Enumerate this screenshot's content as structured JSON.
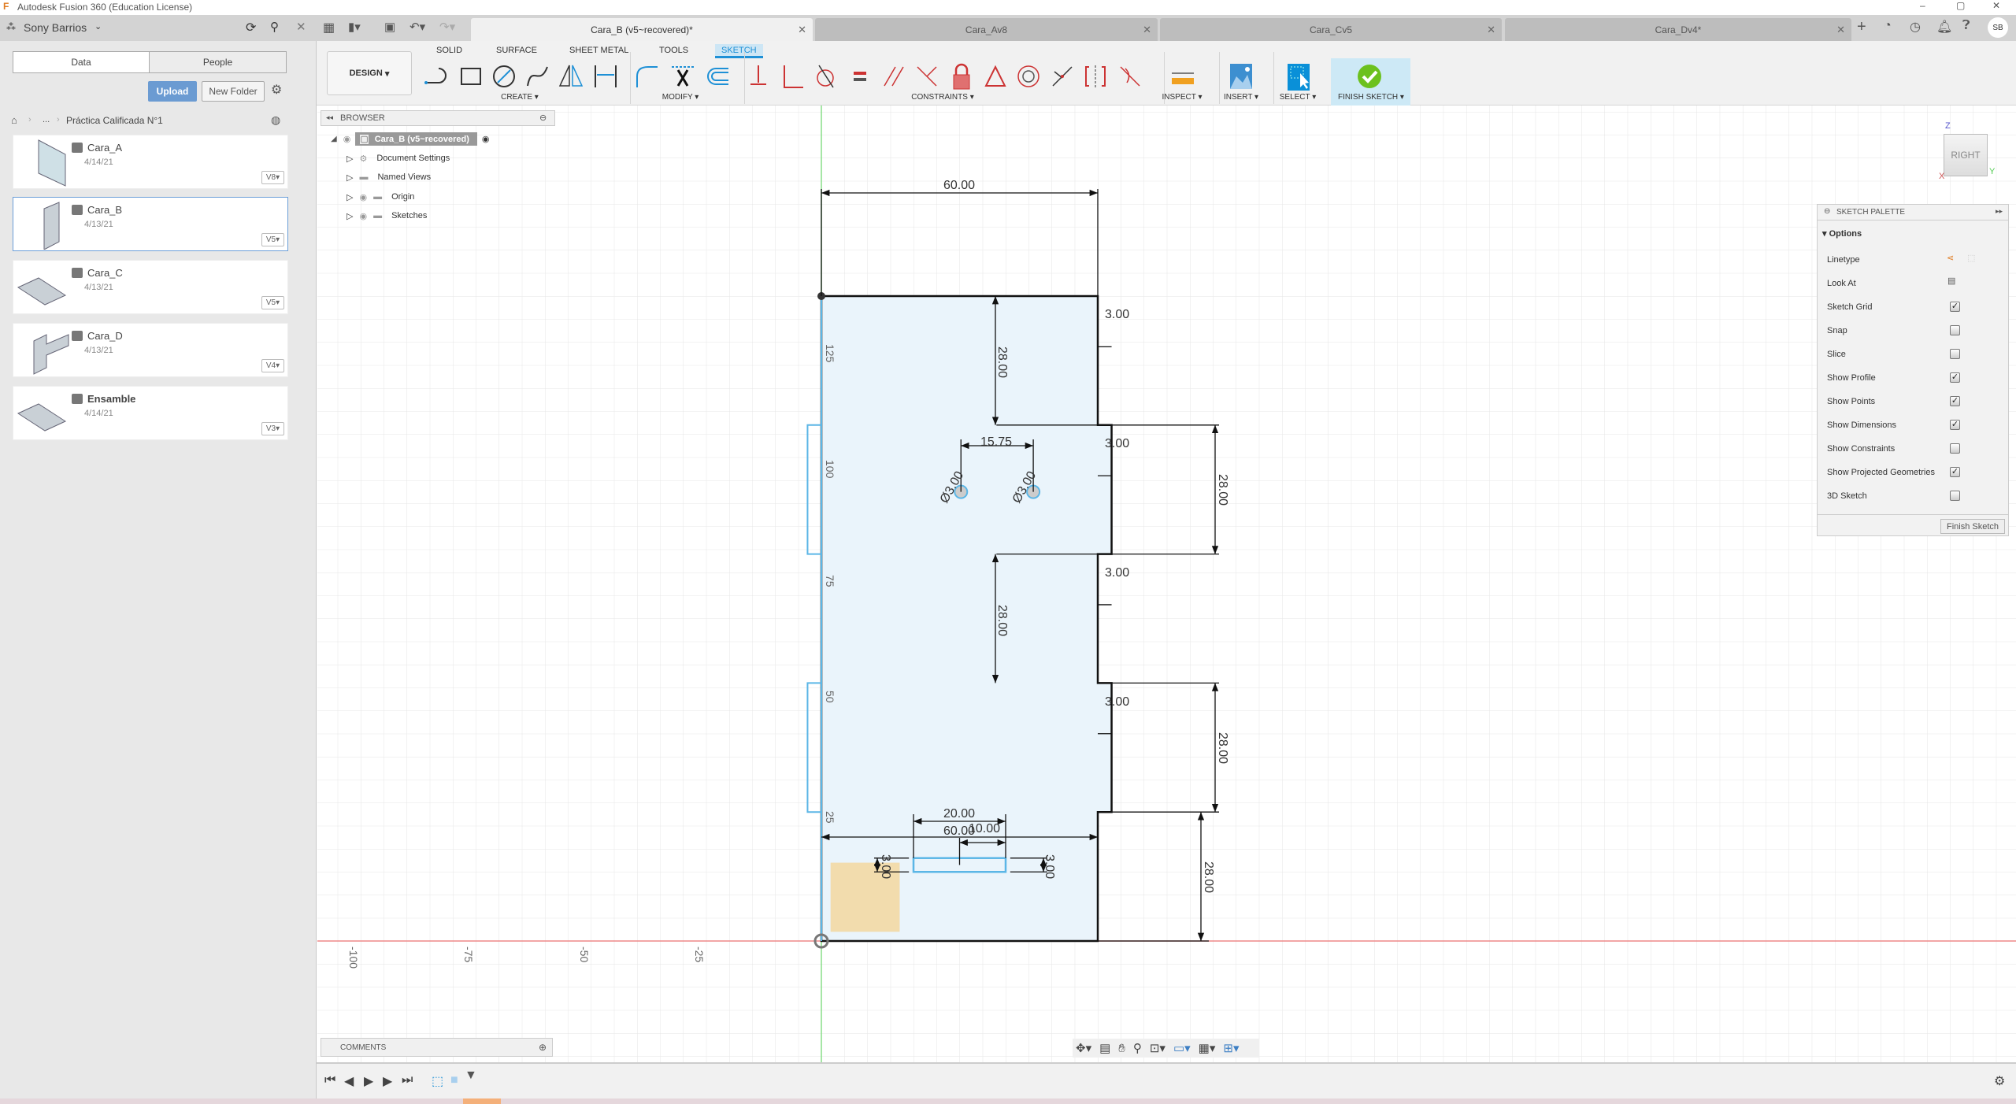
{
  "app": {
    "title": "Autodesk Fusion 360 (Education License)"
  },
  "left_panel": {
    "user": "Sony Barrios",
    "tabs": [
      "Data",
      "People"
    ],
    "upload_label": "Upload",
    "new_folder_label": "New Folder",
    "breadcrumb": {
      "ellipsis": "...",
      "folder": "Práctica Calificada N°1"
    },
    "files": [
      {
        "name": "Cara_A",
        "date": "4/14/21",
        "version": "V8"
      },
      {
        "name": "Cara_B",
        "date": "4/13/21",
        "version": "V5",
        "selected": true
      },
      {
        "name": "Cara_C",
        "date": "4/13/21",
        "version": "V5"
      },
      {
        "name": "Cara_D",
        "date": "4/13/21",
        "version": "V4"
      },
      {
        "name": "Ensamble",
        "date": "4/14/21",
        "version": "V3"
      }
    ]
  },
  "doc_tabs": [
    {
      "label": "Cara_B (v5~recovered)*",
      "active": true
    },
    {
      "label": "Cara_Av8"
    },
    {
      "label": "Cara_Cv5"
    },
    {
      "label": "Cara_Dv4*"
    }
  ],
  "user_initials": "SB",
  "toolbar": {
    "workspace": "DESIGN",
    "tabs": [
      "SOLID",
      "SURFACE",
      "SHEET METAL",
      "TOOLS",
      "SKETCH"
    ],
    "active_tab": "SKETCH",
    "groups": {
      "create": "CREATE",
      "modify": "MODIFY",
      "constraints": "CONSTRAINTS",
      "inspect": "INSPECT",
      "insert": "INSERT",
      "select": "SELECT",
      "finish": "FINISH SKETCH"
    }
  },
  "browser": {
    "title": "BROWSER",
    "root": "Cara_B (v5~recovered)",
    "items": [
      "Document Settings",
      "Named Views",
      "Origin",
      "Sketches"
    ]
  },
  "viewcube": {
    "face": "RIGHT",
    "axis_z": "Z",
    "axis_y": "Y",
    "axis_x": "X"
  },
  "sketch_palette": {
    "title": "SKETCH PALETTE",
    "section": "Options",
    "rows": [
      {
        "label": "Linetype",
        "type": "icons"
      },
      {
        "label": "Look At",
        "type": "icon"
      },
      {
        "label": "Sketch Grid",
        "checked": true
      },
      {
        "label": "Snap",
        "checked": false
      },
      {
        "label": "Slice",
        "checked": false
      },
      {
        "label": "Show Profile",
        "checked": true
      },
      {
        "label": "Show Points",
        "checked": true
      },
      {
        "label": "Show Dimensions",
        "checked": true
      },
      {
        "label": "Show Constraints",
        "checked": false
      },
      {
        "label": "Show Projected Geometries",
        "checked": true
      },
      {
        "label": "3D Sketch",
        "checked": false
      }
    ],
    "finish_label": "Finish Sketch"
  },
  "sketch": {
    "dimensions": {
      "top_width": "60.00",
      "tab1": "3.00",
      "tab2": "3.00",
      "tab3": "3.00",
      "tab4": "3.00",
      "inner_h1": "28.00",
      "inner_h2": "28.00",
      "right_h1": "28.00",
      "right_h2": "28.00",
      "right_h3": "28.00",
      "hole_spacing": "15.75",
      "hole1": "Ø3.00",
      "hole2": "Ø3.00",
      "slot_width": "20.00",
      "bottom_width": "60.00",
      "slot_offset": "10.00",
      "slot_h_left": "3.00",
      "slot_h_right": "3.00"
    },
    "y_ticks": [
      "125",
      "100",
      "75",
      "50",
      "25"
    ],
    "x_ticks": [
      "-100",
      "-75",
      "-50",
      "-25"
    ],
    "colors": {
      "profile": "#eaf4fb",
      "projected": "#5bb6e6",
      "selection": "#f3d9a4",
      "x_axis": "#e88",
      "y_axis": "#8d8"
    }
  },
  "comments": {
    "title": "COMMENTS"
  }
}
